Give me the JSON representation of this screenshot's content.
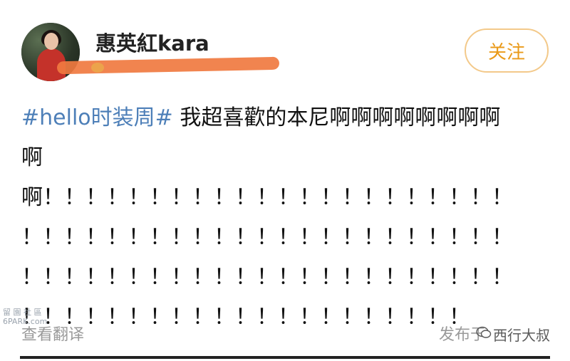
{
  "user": {
    "name": "惠英紅kara",
    "follow_label": "关注"
  },
  "post": {
    "topic": "#hello时装周#",
    "text_line1": " 我超喜歡的本尼啊啊啊啊啊啊啊啊",
    "text_line2": "啊",
    "text_line3": "啊！！！！！！！！！！！！！！！！！！！！！！",
    "text_line4": "！！！！！！！！！！！！！！！！！！！！！！！",
    "text_line5": "！！！！！！！！！！！！！！！！！！！！！！！",
    "text_line6": "！！！！！！！！！！！！！！！！！！！！！"
  },
  "footer": {
    "translate_label": "查看翻译",
    "publish_label": "发布于",
    "watermark_account": "西行大叔",
    "site_watermark_line1": "留 園 社 區",
    "site_watermark_line2": "6PARK.com"
  },
  "colors": {
    "topic": "#4d7fb8",
    "follow_text": "#ea9a19",
    "follow_border": "#f3c98a",
    "redaction": "#f07a40"
  }
}
